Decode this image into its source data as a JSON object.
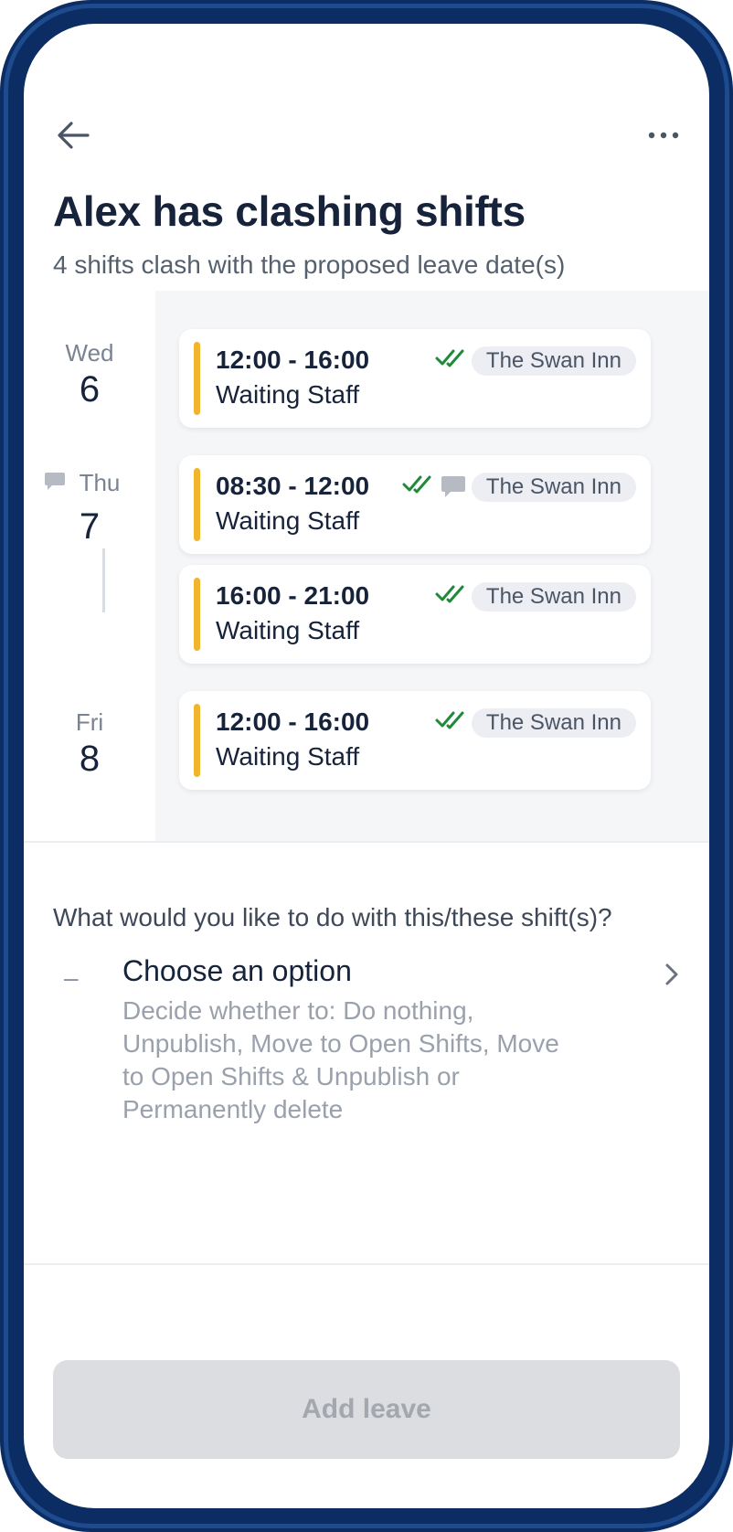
{
  "header": {
    "back_icon": "arrow-left-icon",
    "more_icon": "more-horizontal-icon",
    "title": "Alex has clashing shifts",
    "subtitle": "4 shifts clash with the proposed leave date(s)"
  },
  "days": [
    {
      "name": "Wed",
      "number": "6"
    },
    {
      "name": "Thu",
      "number": "7",
      "has_comment": true
    },
    {
      "name": "Fri",
      "number": "8"
    }
  ],
  "shifts": [
    {
      "time": "12:00 - 16:00",
      "role": "Waiting Staff",
      "location": "The Swan Inn",
      "has_comment": false
    },
    {
      "time": "08:30 - 12:00",
      "role": "Waiting Staff",
      "location": "The Swan Inn",
      "has_comment": true
    },
    {
      "time": "16:00 - 21:00",
      "role": "Waiting Staff",
      "location": "The Swan Inn",
      "has_comment": false
    },
    {
      "time": "12:00 - 16:00",
      "role": "Waiting Staff",
      "location": "The Swan Inn",
      "has_comment": false
    }
  ],
  "action": {
    "question": "What would you like to do with this/these shift(s)?",
    "option_marker": "–",
    "option_title": "Choose an option",
    "option_description": "Decide whether to: Do nothing, Unpublish, Move to Open Shifts, Move to Open Shifts & Unpublish or Permanently delete"
  },
  "footer": {
    "add_leave_label": "Add leave"
  },
  "colors": {
    "frame": "#0b2d63",
    "accent_bar": "#f2b42c",
    "check": "#1f8a3a",
    "button_disabled_bg": "#dcdde0",
    "button_disabled_text": "#a3a7ae"
  }
}
